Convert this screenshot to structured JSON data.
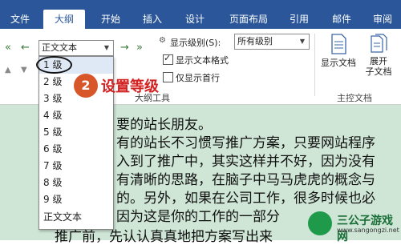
{
  "tabs": [
    {
      "label": "文件"
    },
    {
      "label": "大纲"
    },
    {
      "label": "开始"
    },
    {
      "label": "插入"
    },
    {
      "label": "设计"
    },
    {
      "label": "页面布局"
    },
    {
      "label": "引用"
    },
    {
      "label": "邮件"
    },
    {
      "label": "审阅"
    }
  ],
  "ribbon": {
    "outline_level_combo": "正文文本",
    "show_level_label": "显示级别(S):",
    "show_level_value": "所有级别",
    "show_text_format_label": "显示文本格式",
    "show_text_format_checked": true,
    "first_line_only_label": "仅显示首行",
    "first_line_only_checked": false,
    "group_outline_tools": "大纲工具",
    "show_document_label": "显示文档",
    "expand_subdocs_label_1": "展开",
    "expand_subdocs_label_2": "子文档",
    "group_master_document": "主控文档"
  },
  "dropdown": {
    "items": [
      "1 级",
      "2 级",
      "3 级",
      "4 级",
      "5 级",
      "6 级",
      "7 级",
      "8 级",
      "9 级",
      "正文文本"
    ],
    "highlighted_index": 0
  },
  "annotation": {
    "step_number": "2",
    "text": "设置等级"
  },
  "document": {
    "lines": [
      "要的站长朋友。",
      "有的站长不习惯写推广方案，只要网站程序",
      "入到了推广中，其实这样并不好，因为没有",
      "有清晰的思路，在脑子中马马虎虎的概念与",
      "的。另外，如果在公司工作，很多时候也必",
      "因为这是你的工作的一部分",
      "推广前，先认认真真地把方案写出来"
    ]
  },
  "watermark": {
    "name": "三公子游戏网",
    "url": "www.sangongzi.net"
  },
  "colors": {
    "ribbon_blue": "#2b579a",
    "doc_background": "#cfe6d6",
    "annotation_red": "#d32020",
    "badge_orange": "#d8572a"
  }
}
